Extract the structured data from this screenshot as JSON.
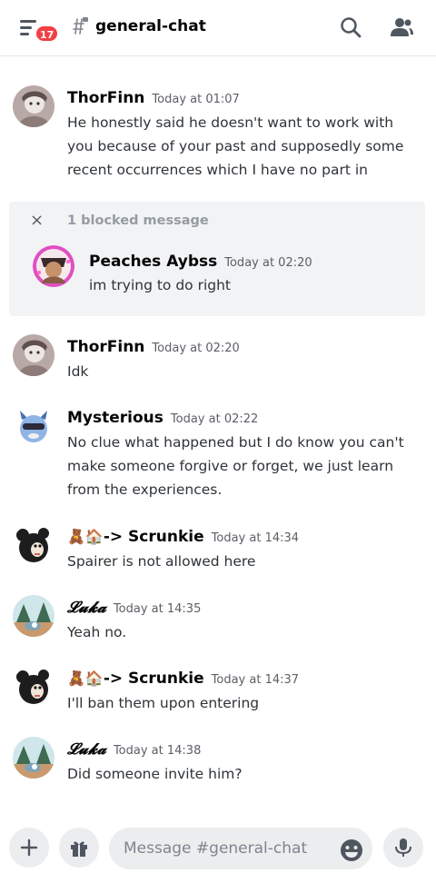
{
  "header": {
    "unread_badge": "17",
    "channel_name": "general-chat",
    "icons": [
      "hamburger-icon",
      "thread-icon",
      "search-icon",
      "members-icon"
    ]
  },
  "messages": [
    {
      "author": "ThorFinn",
      "time": "Today at 01:07",
      "text": "He honestly said he doesn't want to work with you because of your past and supposedly some recent occurrences which I have no part in"
    },
    {
      "author": "ThorFinn",
      "time": "Today at 02:20",
      "text": "Idk"
    },
    {
      "author": "Mysterious",
      "time": "Today at 02:22",
      "text": "No clue what happened but I do know you can't make someone forgive or forget, we just learn from the experiences."
    },
    {
      "author_emoji": "🧸🏠",
      "author": "-> Scrunkie",
      "time": "Today at 14:34",
      "text": "Spairer is not allowed here"
    },
    {
      "author": "𝓛𝓾𝓴𝓪",
      "time": "Today at 14:35",
      "text": "Yeah no."
    },
    {
      "author_emoji": "🧸🏠",
      "author": "-> Scrunkie",
      "time": "Today at 14:37",
      "text": "I'll ban them upon entering"
    },
    {
      "author": "𝓛𝓾𝓴𝓪",
      "time": "Today at 14:38",
      "text": "Did someone invite him?"
    }
  ],
  "blocked": {
    "label": "1 blocked message",
    "close_symbol": "×",
    "author": "Peaches Aybss",
    "time": "Today at 02:20",
    "text": "im trying to do right"
  },
  "composer": {
    "placeholder": "Message #general-chat",
    "icons": [
      "plus-icon",
      "gift-icon",
      "emoji-icon",
      "microphone-icon"
    ]
  },
  "colors": {
    "accent_red": "#f23f43",
    "text_primary": "#060607",
    "text_muted": "#5c5e66",
    "blocked_bg": "#f2f3f5"
  }
}
